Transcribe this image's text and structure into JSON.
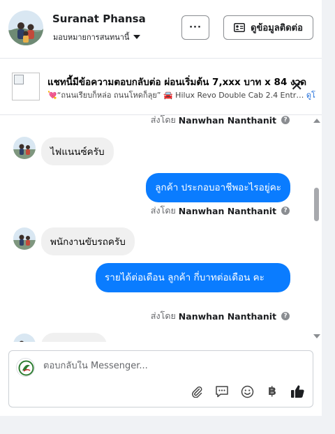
{
  "header": {
    "name": "Suranat Phansa",
    "assignee_label": "มอบหมายการสนทนานี้",
    "more_label": "···",
    "contact_label": "ดูข้อมูลติดต่อ"
  },
  "ad": {
    "title": "แชทนี้มีข้อความตอบกลับต่อ ผ่อนเริ่มต้น 7,xxx บาท x 84 งวด",
    "subtitle": "💘“ถนนเรียบก็หล่อ ถนนโหดก็ลุย” 🚘 Hilux Revo Double Cab 2.4 Entr…",
    "link": "ดูโ"
  },
  "messages": [
    {
      "type": "sent_by",
      "prefix": "ส่งโดย",
      "name": "Nanwhan Nanthanit"
    },
    {
      "type": "incoming",
      "text": "ไฟแนนซ์ครับ"
    },
    {
      "type": "outgoing",
      "text": "ลูกค้า ประกอบอาชีพอะไรอยู่คะ"
    },
    {
      "type": "sent_by",
      "prefix": "ส่งโดย",
      "name": "Nanwhan Nanthanit"
    },
    {
      "type": "incoming",
      "text": "พนักงานขับรถครับ"
    },
    {
      "type": "outgoing",
      "text": "รายได้ต่อเดือน ลูกค้า กี่บาทต่อเดือน คะ"
    },
    {
      "type": "sent_by",
      "prefix": "ส่งโดย",
      "name": "Nanwhan Nanthanit"
    }
  ],
  "composer": {
    "placeholder": "ตอบกลับใน Messenger...",
    "tools": [
      "paperclip-icon",
      "saved-reply-icon",
      "emoji-icon",
      "baht-icon",
      "thumbs-up-icon"
    ]
  },
  "colors": {
    "outgoing_bubble": "#0a7cff",
    "incoming_bubble": "#f0f0f0",
    "like": "#1c1e21"
  }
}
